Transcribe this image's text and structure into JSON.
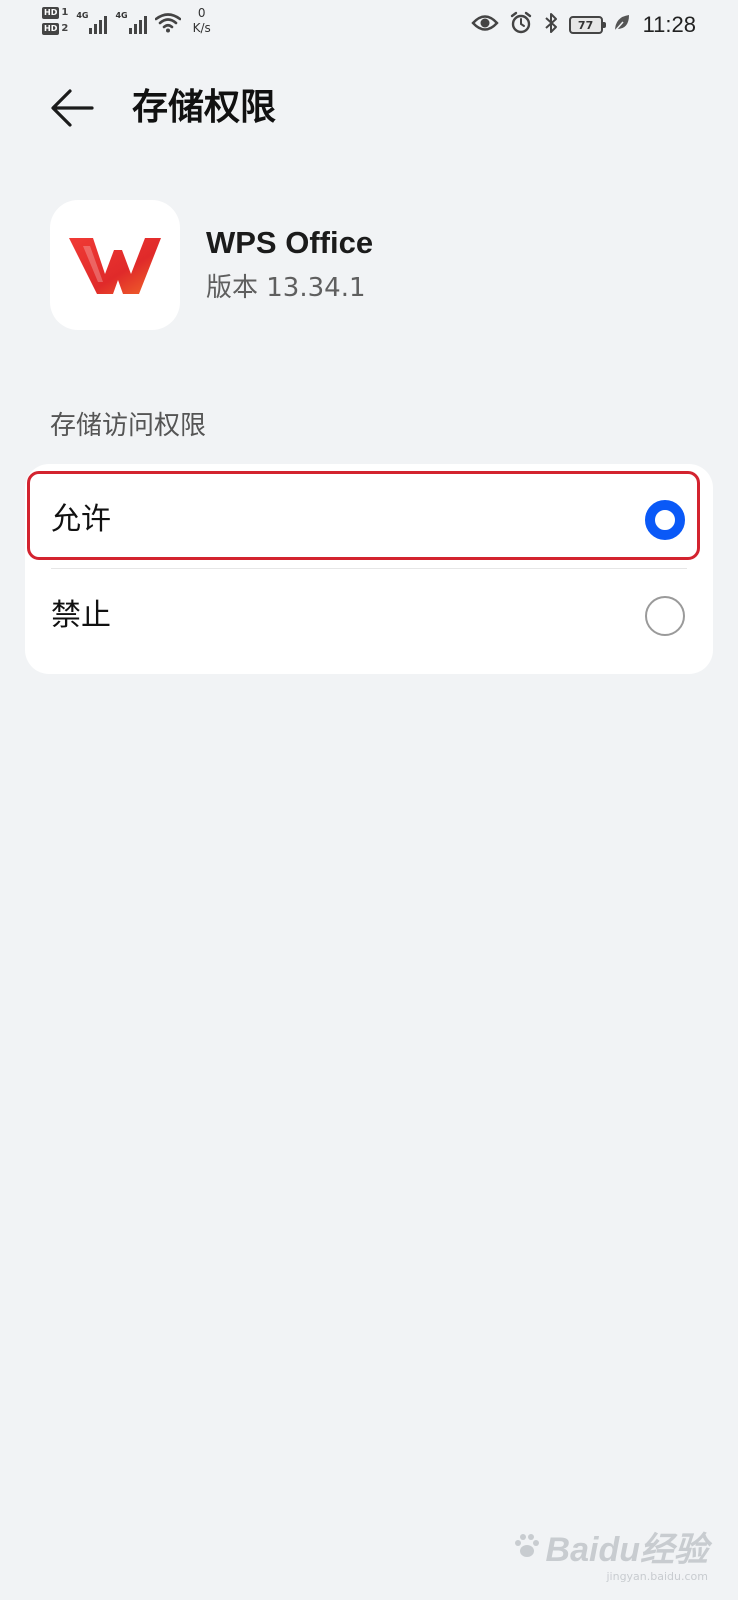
{
  "status_bar": {
    "sim1_label": "HD",
    "sim1_num": "1",
    "sim2_label": "HD",
    "sim2_num": "2",
    "network1": "4G",
    "network2": "4G",
    "speed_value": "0",
    "speed_unit": "K/s",
    "battery_level": "77",
    "time": "11:28",
    "icons": [
      "signal-icon",
      "wifi-icon",
      "eye-icon",
      "alarm-icon",
      "bluetooth-icon",
      "battery-icon",
      "leaf-icon"
    ]
  },
  "header": {
    "back_icon": "back-arrow-icon",
    "title": "存储权限"
  },
  "app": {
    "icon": "wps-office-logo",
    "name": "WPS Office",
    "version": "版本 13.34.1",
    "brand_color": "#e8322e"
  },
  "section": {
    "label": "存储访问权限"
  },
  "options": [
    {
      "label": "允许",
      "selected": true
    },
    {
      "label": "禁止",
      "selected": false
    }
  ],
  "colors": {
    "accent": "#0a59f7",
    "highlight": "#d3232f",
    "background": "#f1f3f5"
  },
  "watermark": {
    "main": "Baidu经验",
    "sub": "jingyan.baidu.com"
  }
}
